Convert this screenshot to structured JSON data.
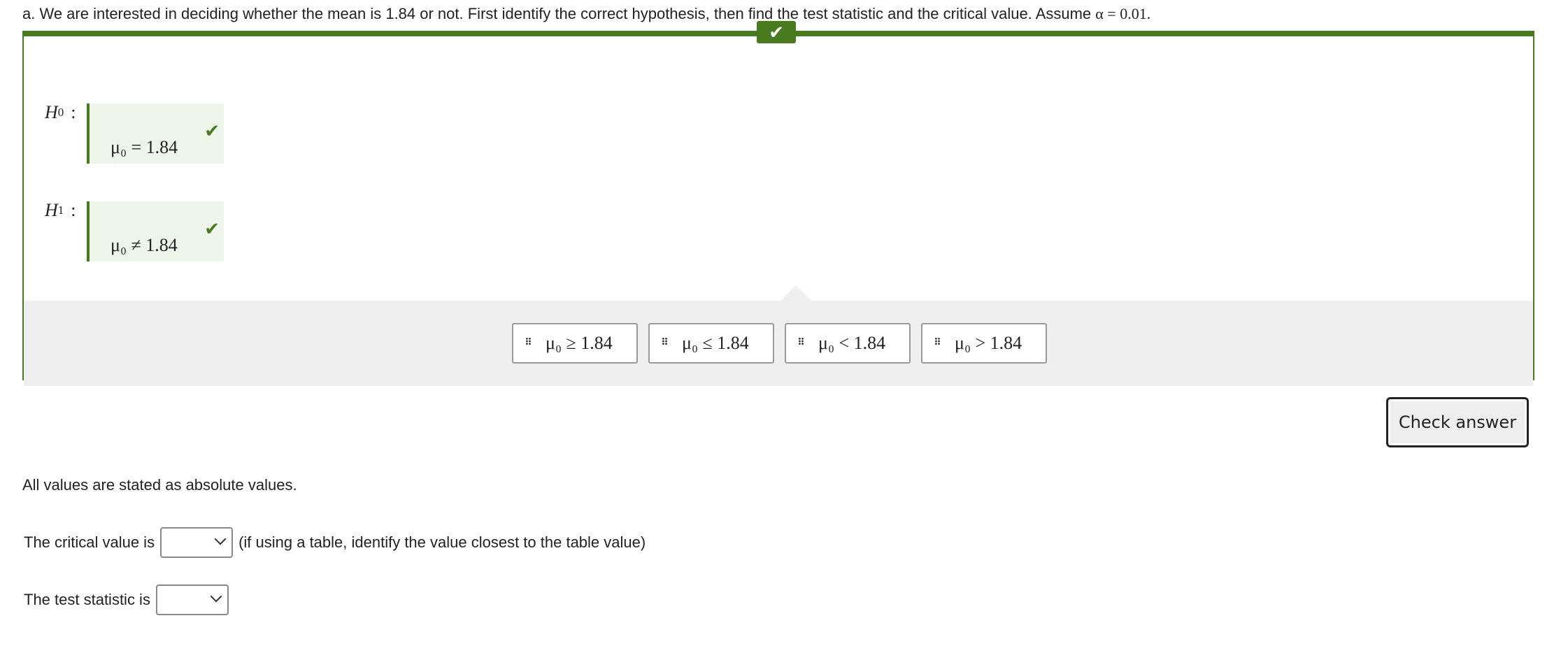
{
  "prompt": {
    "text_before": "a. We are interested in deciding whether the mean is 1.84 or not. First identify the correct hypothesis, then find the test statistic and the critical value. Assume ",
    "alpha_expr": "α = 0.01."
  },
  "hypotheses": {
    "h0": {
      "label": "H",
      "sub": "0",
      "answer": "μ₀ = 1.84",
      "status": "correct"
    },
    "h1": {
      "label": "H",
      "sub": "1",
      "answer": "μ₀ ≠ 1.84",
      "status": "correct"
    }
  },
  "options": [
    {
      "text": "μ₀ ≥ 1.84"
    },
    {
      "text": "μ₀ ≤ 1.84"
    },
    {
      "text": "μ₀ < 1.84"
    },
    {
      "text": "μ₀ > 1.84"
    }
  ],
  "check_answer": "Check answer",
  "note": "All values are stated as absolute values.",
  "critical_value": {
    "label": "The critical value is",
    "selected": "",
    "hint": "(if using a table, identify the value closest to the table value)"
  },
  "test_statistic": {
    "label": "The test statistic is",
    "selected": ""
  },
  "colors": {
    "accent_green": "#4a7a1f",
    "drop_zone_bg": "#eef5ea",
    "tray_bg": "#efefef"
  },
  "icons": {
    "panel_status": "checkmark-icon",
    "option_handle": "drag-handle-icon",
    "select_arrow": "chevron-down-icon"
  }
}
